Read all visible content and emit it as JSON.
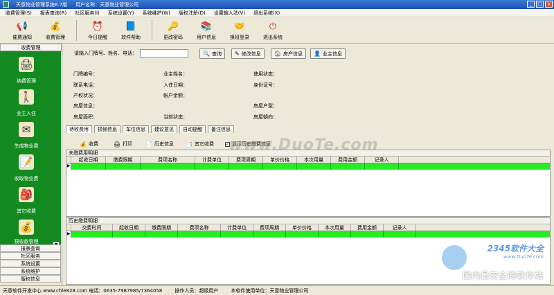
{
  "window": {
    "title": "天意物业管理系统6.7版",
    "user_label": "用户名称：天意物业管理公司",
    "min": "_",
    "max": "□",
    "close": "×"
  },
  "menu": [
    "收费管理(S)",
    "报表查询(R)",
    "社区服务(I)",
    "系统设置(Y)",
    "系统维护(W)",
    "版权注册(D)",
    "设置输入法(V)",
    "退出系统(X)"
  ],
  "toolbar": [
    {
      "label": "催费通知",
      "icon": "megaphone-icon",
      "glyph": "📢"
    },
    {
      "label": "收费管理",
      "icon": "money-icon",
      "glyph": "💰"
    },
    {
      "label": "今日提醒",
      "icon": "alarm-clock-icon",
      "glyph": "⏰"
    },
    {
      "label": "软件帮助",
      "icon": "help-book-icon",
      "glyph": "📘"
    },
    {
      "label": "更改密码",
      "icon": "key-icon",
      "glyph": "🔑"
    },
    {
      "label": "用户信息",
      "icon": "books-icon",
      "glyph": "📚"
    },
    {
      "label": "换班登录",
      "icon": "handshake-icon",
      "glyph": "🤝"
    },
    {
      "label": "退出系统",
      "icon": "exit-icon",
      "glyph": "⏻"
    }
  ],
  "sidebar": {
    "header": "收费管理",
    "items": [
      {
        "label": "纳费管理",
        "icon": "pay-management-icon",
        "glyph": "🖨"
      },
      {
        "label": "业主入住",
        "icon": "owner-checkin-icon",
        "glyph": "🚶"
      },
      {
        "label": "生成物业费",
        "icon": "generate-fee-icon",
        "glyph": "✉"
      },
      {
        "label": "收取物业费",
        "icon": "collect-fee-icon",
        "glyph": "📝"
      },
      {
        "label": "其它收费",
        "icon": "other-fee-icon",
        "glyph": "🎒"
      },
      {
        "label": "预收款管理",
        "icon": "prepayment-icon",
        "glyph": "💰"
      }
    ],
    "scroll_glyph": "▼",
    "tabs": [
      "报表查询",
      "社区服务",
      "系统设置",
      "系统维护",
      "版权信息"
    ]
  },
  "search": {
    "label": "请输入门牌号、姓名、电话：",
    "value": "",
    "buttons": [
      {
        "label": "查询",
        "icon": "search-icon",
        "glyph": "🔍"
      },
      {
        "label": "修改信息",
        "icon": "edit-icon",
        "glyph": "✎"
      },
      {
        "label": "房产信息",
        "icon": "house-icon",
        "glyph": "🏠"
      },
      {
        "label": "业主信息",
        "icon": "person-icon",
        "glyph": "👤"
      }
    ]
  },
  "info": {
    "col1": [
      "门牌编号：",
      "联系电话：",
      "产权状况：",
      "房屋信息：",
      "房屋面积："
    ],
    "col2": [
      "业主姓名：",
      "入住日期：",
      "帐户余额：",
      "",
      "当前状态："
    ],
    "col3": [
      "使用状态：",
      "身份证号：",
      "",
      "房屋户型：",
      "房屋朝向："
    ]
  },
  "tabs": [
    "待收费用",
    "损修信息",
    "车位信息",
    "建议意见",
    "自动提醒",
    "备注信息"
  ],
  "actions": {
    "collect": "收费",
    "print": "打印",
    "history": "历史信息",
    "other": "其它收费",
    "show_history": "显示历史缴费信息",
    "checked_glyph": "✓"
  },
  "unpaid": {
    "title": "未缴费用明细",
    "columns": [
      "起收日期",
      "缴费限期",
      "费项名称",
      "计费单位",
      "费项周期",
      "单价价格",
      "本次用量",
      "费用金额",
      "记录人"
    ],
    "row_indicator": "▶"
  },
  "history": {
    "title": "历史缴费明细",
    "columns": [
      "交费时间",
      "起收日期",
      "缴费限期",
      "费项名称",
      "计费单位",
      "费项周期",
      "单价价格",
      "本次用量",
      "费用金额",
      "记录人"
    ],
    "row_indicator": "▶"
  },
  "status": {
    "developer": "天意软件开发中心 www.chle828.com 电话：0635-7987985/7364058",
    "operator": "操作人员：超级用户",
    "unit": "本软件使用单位：天意物业管理公司"
  },
  "watermark": {
    "text": "www.DuoTe.com",
    "brand": "2345软件大全",
    "brand_url": "www.DuoTe.com",
    "slogan": "国内最安全的软件站"
  }
}
